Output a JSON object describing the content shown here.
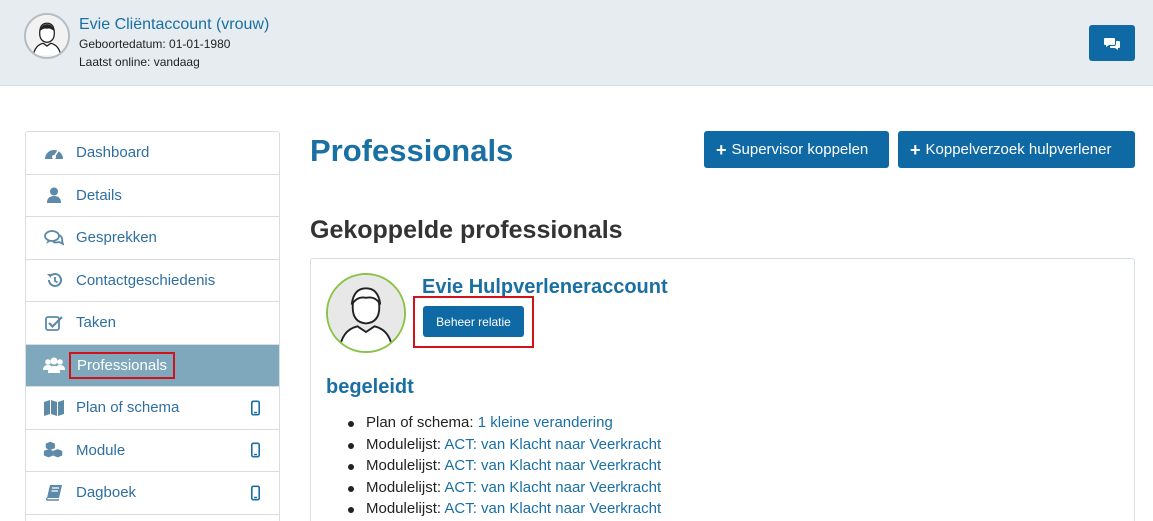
{
  "header": {
    "name": "Evie Cliëntaccount (vrouw)",
    "dob": "Geboortedatum: 01-01-1980",
    "online": "Laatst online: vandaag",
    "chat_icon": "comments-icon"
  },
  "sidebar": {
    "items": [
      {
        "label": "Dashboard",
        "icon": "dashboard-icon"
      },
      {
        "label": "Details",
        "icon": "user-icon"
      },
      {
        "label": "Gesprekken",
        "icon": "comments-icon"
      },
      {
        "label": "Contactgeschiedenis",
        "icon": "history-icon"
      },
      {
        "label": "Taken",
        "icon": "checkbox-icon"
      },
      {
        "label": "Professionals",
        "icon": "users-icon",
        "active": true
      },
      {
        "label": "Plan of schema",
        "icon": "map-icon",
        "mobile": true
      },
      {
        "label": "Module",
        "icon": "cubes-icon",
        "mobile": true
      },
      {
        "label": "Dagboek",
        "icon": "book-icon",
        "mobile": true
      }
    ]
  },
  "main": {
    "title": "Professionals",
    "buttons": {
      "supervisor": "Supervisor koppelen",
      "koppelverzoek": "Koppelverzoek hulpverlener"
    },
    "section_title": "Gekoppelde professionals",
    "card": {
      "name": "Evie Hulpverleneraccount",
      "manage_button": "Beheer relatie",
      "relation_type": "begeleidt",
      "items": [
        {
          "prefix": "Plan of schema: ",
          "link": "1 kleine verandering"
        },
        {
          "prefix": "Modulelijst: ",
          "link": "ACT: van Klacht naar Veerkracht"
        },
        {
          "prefix": "Modulelijst: ",
          "link": "ACT: van Klacht naar Veerkracht"
        },
        {
          "prefix": "Modulelijst: ",
          "link": "ACT: van Klacht naar Veerkracht"
        },
        {
          "prefix": "Modulelijst: ",
          "link": "ACT: van Klacht naar Veerkracht"
        }
      ]
    }
  },
  "colors": {
    "accent": "#0f69a5",
    "link": "#1a6fa3",
    "header_bg": "#e6ecf0",
    "active_nav": "#7fa8bd",
    "highlight": "#d0121b",
    "avatar_ring": "#8bc34a"
  }
}
